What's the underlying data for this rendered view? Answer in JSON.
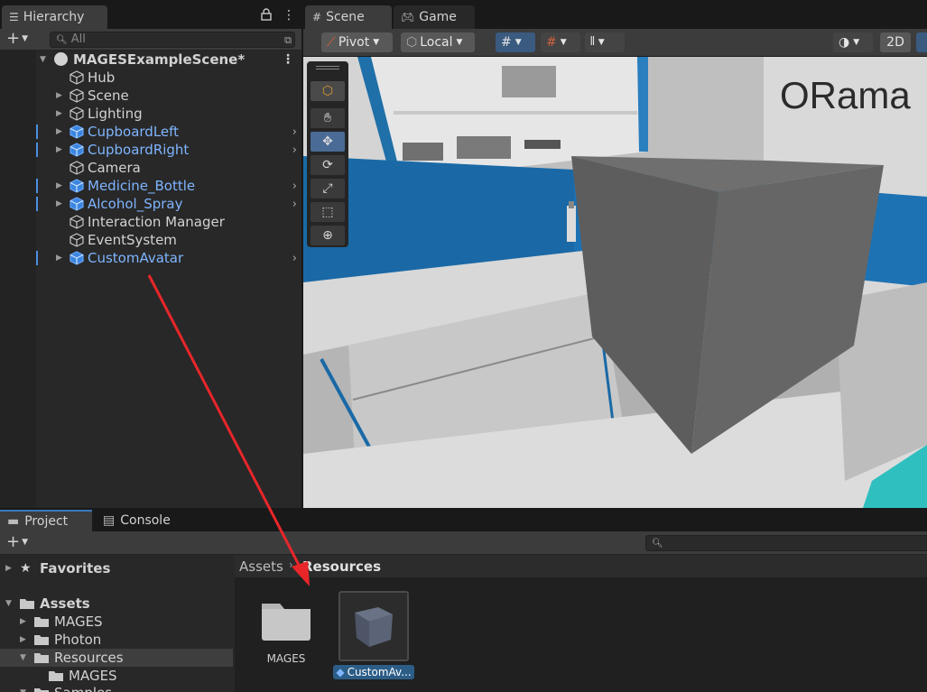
{
  "hierarchy": {
    "tab_label": "Hierarchy",
    "search_placeholder": "All",
    "scene_name": "MAGESExampleScene*",
    "items": [
      {
        "label": "Hub",
        "prefab": false,
        "expandable": false
      },
      {
        "label": "Scene",
        "prefab": false,
        "expandable": true
      },
      {
        "label": "Lighting",
        "prefab": false,
        "expandable": true
      },
      {
        "label": "CupboardLeft",
        "prefab": true,
        "expandable": true
      },
      {
        "label": "CupboardRight",
        "prefab": true,
        "expandable": true
      },
      {
        "label": "Camera",
        "prefab": false,
        "expandable": false
      },
      {
        "label": "Medicine_Bottle",
        "prefab": true,
        "expandable": true
      },
      {
        "label": "Alcohol_Spray",
        "prefab": true,
        "expandable": true
      },
      {
        "label": "Interaction Manager",
        "prefab": false,
        "expandable": false
      },
      {
        "label": "EventSystem",
        "prefab": false,
        "expandable": false
      },
      {
        "label": "CustomAvatar",
        "prefab": true,
        "expandable": true
      }
    ]
  },
  "scene": {
    "tabs": [
      {
        "label": "Scene",
        "icon": "grid-icon"
      },
      {
        "label": "Game",
        "icon": "gamepad-icon"
      }
    ],
    "toolbar": {
      "pivot_label": "Pivot",
      "local_label": "Local",
      "mode_2d_label": "2D"
    },
    "tools": [
      "view-tool",
      "move-tool",
      "rotate-tool",
      "scale-tool",
      "rect-tool",
      "transform-tool"
    ],
    "wall_logo_text": "ORama"
  },
  "project": {
    "tabs": [
      {
        "label": "Project",
        "icon": "folder-icon"
      },
      {
        "label": "Console",
        "icon": "console-icon"
      }
    ],
    "tree": [
      {
        "label": "Favorites",
        "level": 0,
        "icon": "star-icon",
        "bold": true,
        "expanded": false
      },
      {
        "label": "Assets",
        "level": 0,
        "icon": "folder-icon",
        "bold": true,
        "expanded": true
      },
      {
        "label": "MAGES",
        "level": 1,
        "icon": "folder-icon",
        "expanded": false
      },
      {
        "label": "Photon",
        "level": 1,
        "icon": "folder-icon",
        "expanded": false
      },
      {
        "label": "Resources",
        "level": 1,
        "icon": "folder-open-icon",
        "expanded": true,
        "selected": true
      },
      {
        "label": "MAGES",
        "level": 2,
        "icon": "folder-icon",
        "expanded": false,
        "leaf": true
      },
      {
        "label": "Samples",
        "level": 1,
        "icon": "folder-icon",
        "expanded": true
      }
    ],
    "breadcrumb": [
      "Assets",
      "Resources"
    ],
    "grid_items": [
      {
        "label": "MAGES",
        "icon": "folder-icon"
      },
      {
        "label": "CustomAv...",
        "icon": "prefab-icon",
        "selected": true
      }
    ]
  },
  "annotation": {
    "color": "#e8262a",
    "description": "red-arrow-from-CustomAvatar-to-Resources"
  }
}
